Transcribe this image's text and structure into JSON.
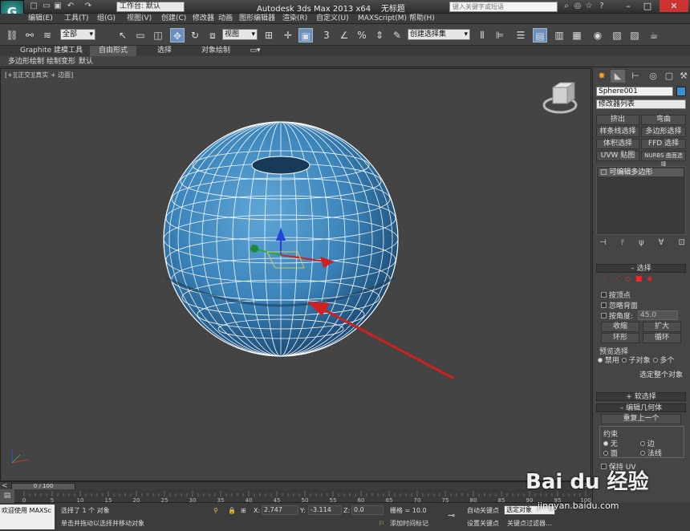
{
  "titlebar": {
    "workspace": "工作台: 默认",
    "title": "Autodesk 3ds Max  2013 x64",
    "filename": "无标题",
    "search_placeholder": "键入关键字或短语"
  },
  "menu": [
    "编辑(E)",
    "工具(T)",
    "组(G)",
    "视图(V)",
    "创建(C)",
    "修改器",
    "动画",
    "图形编辑器",
    "渲染(R)",
    "自定义(U)",
    "MAXScript(M)",
    "帮助(H)"
  ],
  "toolbar": {
    "filter": "全部",
    "coord": "视图",
    "named_sel": "创建选择集"
  },
  "ribbon": {
    "tabs": [
      "Graphite 建模工具",
      "自由形式",
      "选择",
      "对象绘制"
    ],
    "sub": [
      "多边形绘制",
      "绘制变形",
      "默认"
    ]
  },
  "viewport": {
    "label": "[+][正交][真实 + 边面]"
  },
  "panel": {
    "object_name": "Sphere001",
    "object_color": "#3a8fd0",
    "modifier_list": "修改器列表",
    "mod_buttons": [
      "挤出",
      "弯曲",
      "样条线选择",
      "多边形选择",
      "体积选择",
      "FFD 选择",
      "UVW 贴图",
      "NURBS 曲面选择"
    ],
    "stack_item": "可编辑多边形",
    "rollout_select": "选择",
    "by_vertex": "按顶点",
    "ignore_backface": "忽略背面",
    "by_angle": "按角度:",
    "angle_value": "45.0",
    "shrink": "收缩",
    "grow": "扩大",
    "ring": "环形",
    "loop": "循环",
    "preview_sel": "预览选择",
    "disabled": "禁用",
    "subobj": "子对象",
    "multi": "多个",
    "select_whole": "选定整个对象",
    "soft_sel": "软选择",
    "edit_geom": "编辑几何体",
    "repeat_last": "重复上一个",
    "constraints": "约束",
    "c_none": "无",
    "c_edge": "边",
    "c_face": "面",
    "c_normal": "法线",
    "preserve_uv": "保持 UV"
  },
  "timeline": {
    "thumb": "0 / 100",
    "ticks": [
      "0",
      "5",
      "10",
      "15",
      "20",
      "25",
      "30",
      "35",
      "40",
      "45",
      "50",
      "55",
      "60",
      "65",
      "70",
      "75",
      "80",
      "85",
      "90",
      "95",
      "100"
    ]
  },
  "status": {
    "welcome": "欢迎使用 MAXSc",
    "selected": "选择了 1 个 对象",
    "hint": "单击并拖动以选择并移动对象",
    "x_label": "X:",
    "x": "2.747",
    "y_label": "Y:",
    "y": "-3.114",
    "z_label": "Z:",
    "z": "0.0",
    "grid": "栅格 = 10.0",
    "add_time_tag": "添加时间标记",
    "auto_key": "自动关键点",
    "selected_obj": "选定对象",
    "set_key": "设置关键点",
    "key_filters": "关键点过滤器..."
  },
  "watermark": {
    "brand": "Bai du 经验",
    "url": "jingyan.baidu.com"
  }
}
